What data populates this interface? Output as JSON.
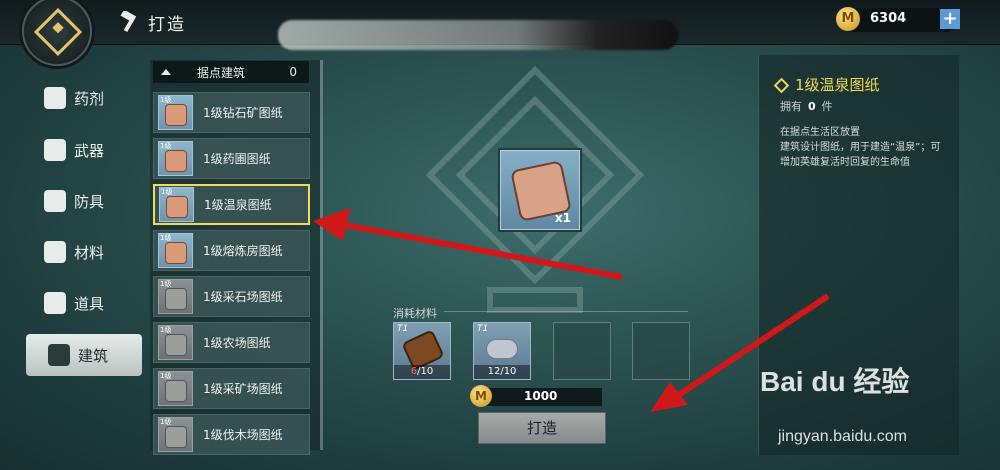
{
  "header": {
    "title": "打造",
    "coins": "6304",
    "plus_label": "+"
  },
  "nav": [
    {
      "label": "药剂",
      "icon": "potion-icon",
      "active": false
    },
    {
      "label": "武器",
      "icon": "sword-icon",
      "active": false
    },
    {
      "label": "防具",
      "icon": "armor-icon",
      "active": false
    },
    {
      "label": "材料",
      "icon": "material-icon",
      "active": false
    },
    {
      "label": "道具",
      "icon": "bag-icon",
      "active": false
    },
    {
      "label": "建筑",
      "icon": "building-icon",
      "active": true
    }
  ],
  "list": {
    "header": {
      "label": "据点建筑",
      "count": "0"
    },
    "items": [
      {
        "name": "1级钻石矿图纸",
        "gray": false,
        "tier": "1级"
      },
      {
        "name": "1级药圃图纸",
        "gray": false,
        "tier": "1级"
      },
      {
        "name": "1级温泉图纸",
        "gray": false,
        "selected": true,
        "tier": "1级"
      },
      {
        "name": "1级熔炼房图纸",
        "gray": false,
        "tier": "1级"
      },
      {
        "name": "1级采石场图纸",
        "gray": true,
        "tier": "1级"
      },
      {
        "name": "1级农场图纸",
        "gray": true,
        "tier": "1级"
      },
      {
        "name": "1级采矿场图纸",
        "gray": true,
        "tier": "1级"
      },
      {
        "name": "1级伐木场图纸",
        "gray": true,
        "tier": "1级"
      }
    ]
  },
  "craft": {
    "item_qty": "x1",
    "materials_label": "消耗材料",
    "materials": [
      {
        "tier": "T1",
        "count_have": "6",
        "count_need": "10",
        "icon": "log-icon"
      },
      {
        "tier": "T1",
        "count_have": "12",
        "count_need": "10",
        "icon": "ore-icon"
      }
    ],
    "cost": "1000",
    "button": "打造"
  },
  "detail": {
    "title": "1级温泉图纸",
    "own_label": "拥有",
    "own_count": "0",
    "own_unit": "件",
    "description": "在据点生活区放置\n建筑设计图纸，用于建造“温泉”；可增加英雄复活时回复的生命值"
  },
  "watermark": {
    "brand": "Bai du 经验",
    "url": "jingyan.baidu.com"
  },
  "colors": {
    "accent": "#f2dc57",
    "arrow": "#d01818",
    "coin": "#e4b24a"
  }
}
